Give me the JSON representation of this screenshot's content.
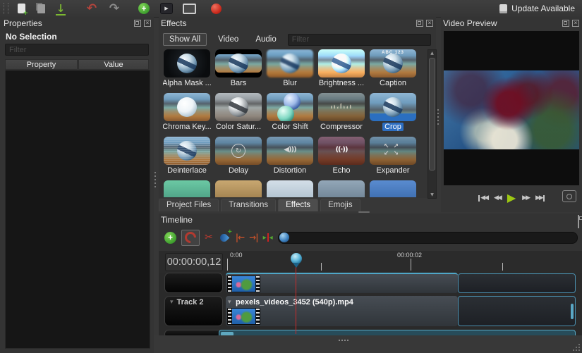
{
  "window": {
    "update_label": "Update Available"
  },
  "toolbar": {
    "icons": [
      "new-project",
      "open-project",
      "save-project",
      "undo",
      "redo",
      "import-files",
      "launch-player",
      "fullscreen",
      "export-video"
    ]
  },
  "properties_panel": {
    "title": "Properties",
    "status": "No Selection",
    "filter_placeholder": "Filter",
    "columns": [
      "Property",
      "Value"
    ]
  },
  "effects_panel": {
    "title": "Effects",
    "filter_buttons": [
      "Show All",
      "Video",
      "Audio"
    ],
    "active_filter": "Show All",
    "filter_placeholder": "Filter",
    "caption_sample": "ABC 123",
    "effects": [
      {
        "label": "Alpha Mask ..."
      },
      {
        "label": "Bars"
      },
      {
        "label": "Blur"
      },
      {
        "label": "Brightness ..."
      },
      {
        "label": "Caption"
      },
      {
        "label": "Chroma Key..."
      },
      {
        "label": "Color Satur..."
      },
      {
        "label": "Color Shift"
      },
      {
        "label": "Compressor"
      },
      {
        "label": "Crop",
        "selected": true
      },
      {
        "label": "Deinterlace"
      },
      {
        "label": "Delay"
      },
      {
        "label": "Distortion"
      },
      {
        "label": "Echo"
      },
      {
        "label": "Expander"
      }
    ]
  },
  "video_preview": {
    "title": "Video Preview"
  },
  "dock_tabs": {
    "items": [
      "Project Files",
      "Transitions",
      "Effects",
      "Emojis"
    ],
    "active": "Effects"
  },
  "timeline": {
    "title": "Timeline",
    "timecode": "00:00:00,12",
    "ruler": {
      "label_start": "0:00",
      "label_2s": "00:00:02"
    },
    "tracks": [
      {
        "label": ""
      },
      {
        "label": "Track 2",
        "clip_title": "pexels_videos_3452 (540p).mp4"
      }
    ]
  },
  "icons": {
    "undo": "↶",
    "redo": "↷",
    "play": "▶",
    "rewind": "◀◀",
    "fast_forward": "▶▶",
    "scissors": "✂",
    "marker_prev": "|←",
    "marker_next": "→|",
    "tri_right": "▸",
    "tri_left": "◂",
    "chevron_down": "▾",
    "plus": "+",
    "play_small": "▶",
    "delay": "↻",
    "distortion": "◀)))",
    "echo": "((·))",
    "expander": "↖↗\n↙↘",
    "up_arrow": "▲",
    "down_arrow": "▼",
    "save_arrow": "↓",
    "close": "×"
  },
  "colors": {
    "selection_blue": "#2d6ec1",
    "clip_accent_teal": "#4fa7c8",
    "play_green": "#9dc813",
    "record_red": "#c8281b",
    "playhead_red": "#cc2a2a"
  }
}
